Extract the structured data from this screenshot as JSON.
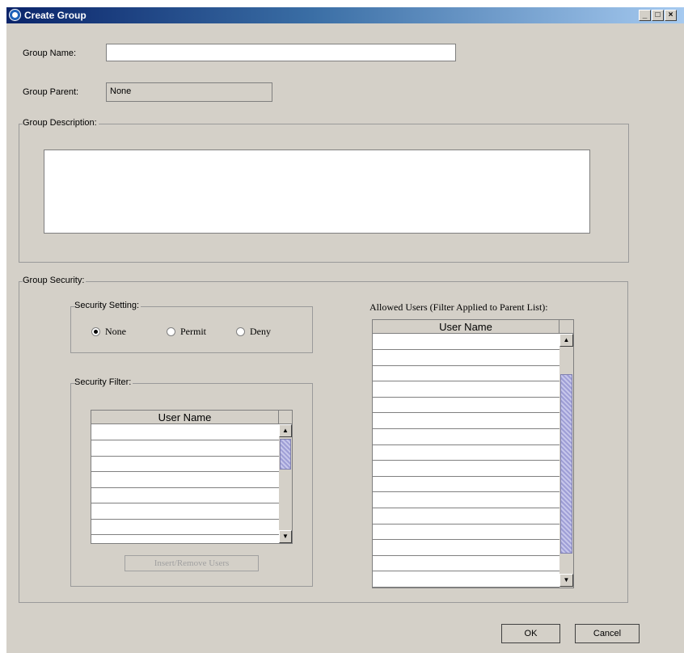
{
  "window": {
    "title": "Create Group",
    "controls": [
      "_",
      "□",
      "×"
    ]
  },
  "form": {
    "group_name_label": "Group Name:",
    "group_name_value": "",
    "group_parent_label": "Group Parent:",
    "group_parent_value": "None",
    "group_description_label": "Group Description:",
    "group_description_value": ""
  },
  "security": {
    "group_security_label": "Group Security:",
    "security_setting_label": "Security Setting:",
    "options": [
      {
        "label": "None",
        "selected": true
      },
      {
        "label": "Permit",
        "selected": false
      },
      {
        "label": "Deny",
        "selected": false
      }
    ],
    "security_filter_label": "Security Filter:",
    "filter_column": "User Name",
    "insert_remove_label": "Insert/Remove Users",
    "allowed_users_label": "Allowed Users (Filter Applied to Parent List):",
    "allowed_column": "User Name"
  },
  "buttons": {
    "ok": "OK",
    "cancel": "Cancel"
  }
}
